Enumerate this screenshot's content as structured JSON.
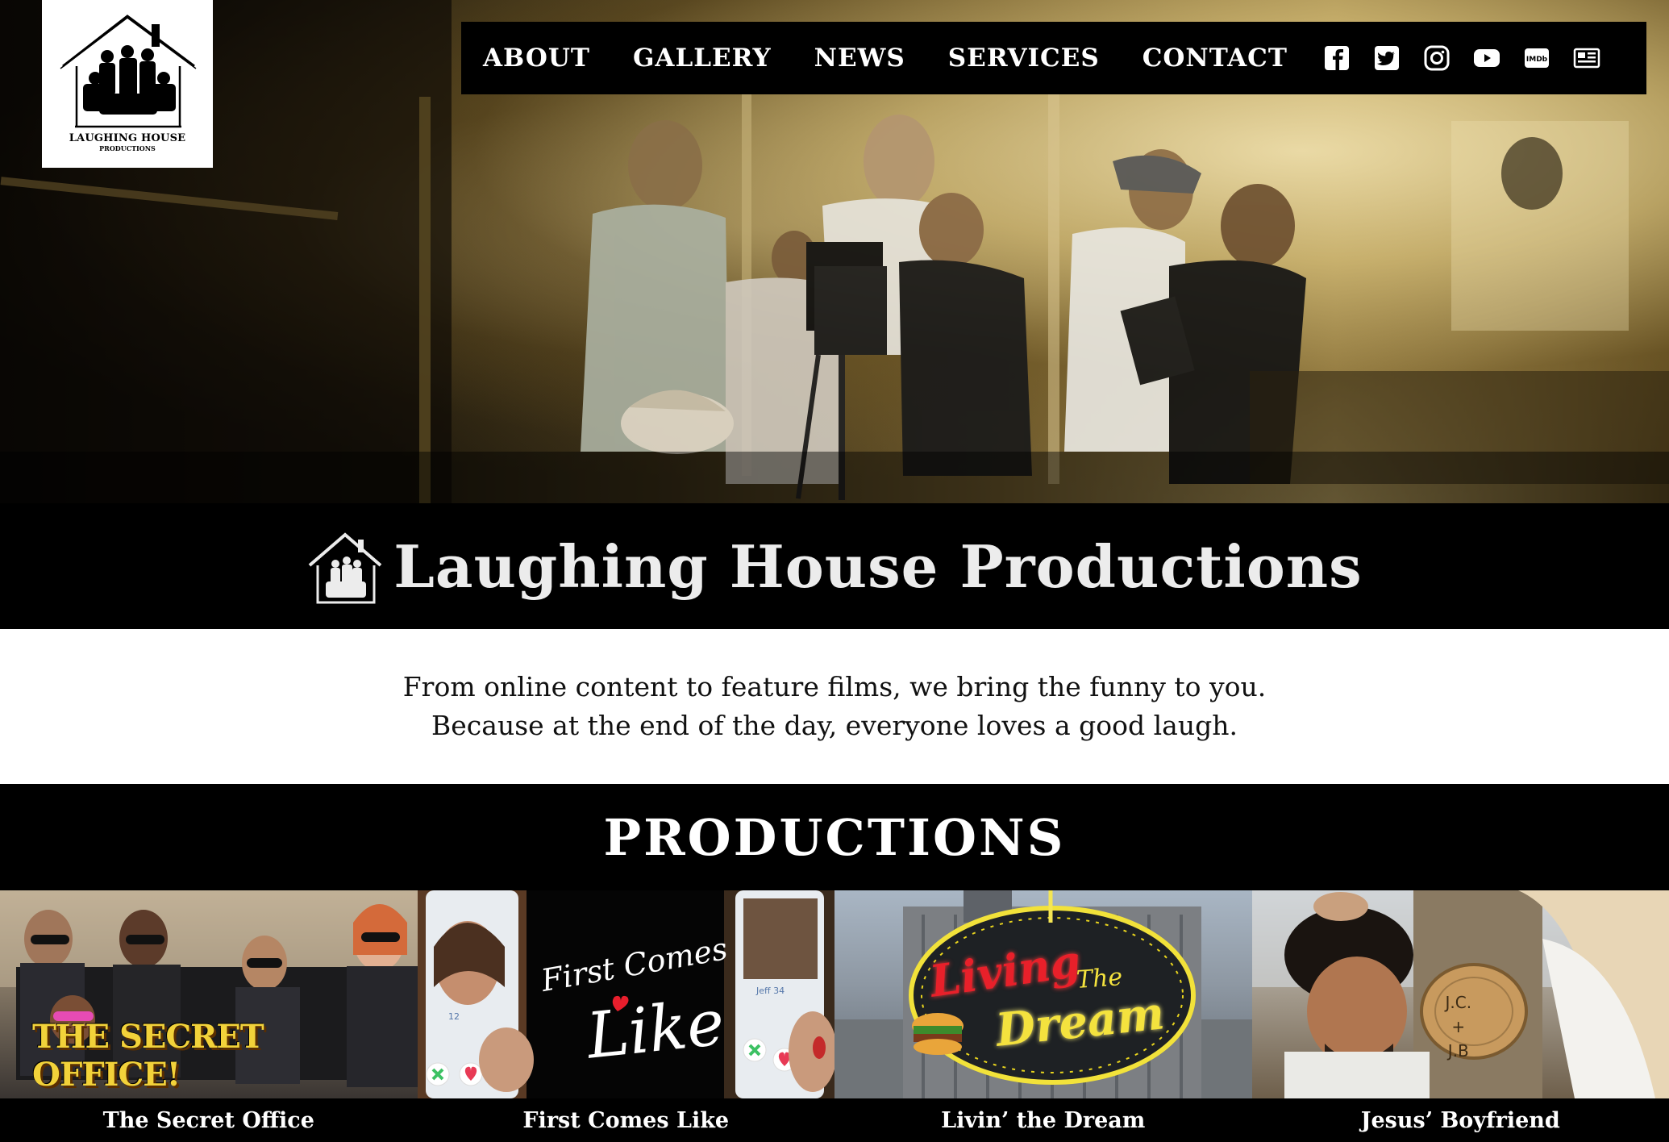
{
  "logo": {
    "line1": "LAUGHING HOUSE",
    "line2": "PRODUCTIONS"
  },
  "nav": {
    "links": [
      "ABOUT",
      "GALLERY",
      "NEWS",
      "SERVICES",
      "CONTACT"
    ],
    "icons": [
      "facebook-icon",
      "twitter-icon",
      "instagram-icon",
      "youtube-icon",
      "imdb-icon",
      "newsletter-icon"
    ],
    "imdb_label": "IMDb"
  },
  "title": "Laughing House Productions",
  "tagline": {
    "line1": "From online content to feature films, we bring the funny to you.",
    "line2": "Because at the end of the day, everyone loves a good laugh."
  },
  "productions": {
    "heading": "PRODUCTIONS",
    "items": [
      {
        "caption": "The Secret Office",
        "art_text": "THE SECRET OFFICE!"
      },
      {
        "caption": "First Comes Like",
        "art_text1": "First Comes",
        "art_text2": "Like",
        "phone_left_num": "12",
        "phone_right_label": "Jeff 34"
      },
      {
        "caption": "Livin’ the Dream",
        "art_text1": "Living",
        "art_text2": "The",
        "art_text3": "Dream"
      },
      {
        "caption": "Jesus’ Boyfriend",
        "art_text1": "J.C.",
        "art_text2": "+",
        "art_text3": "J.B"
      }
    ]
  },
  "colors": {
    "background": "#000000",
    "nav_bg": "#000000",
    "text_light": "#ffffff",
    "tagline_bg": "#ffffff"
  }
}
